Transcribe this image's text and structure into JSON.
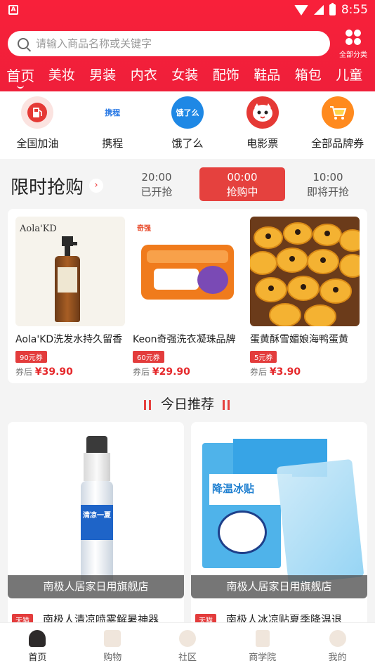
{
  "status": {
    "time": "8:55",
    "app_badge": "A"
  },
  "search": {
    "placeholder": "请输入商品名称或关键字"
  },
  "all_categories": {
    "label": "全部分类"
  },
  "tabs": [
    {
      "label": "首页"
    },
    {
      "label": "美妆"
    },
    {
      "label": "男装"
    },
    {
      "label": "内衣"
    },
    {
      "label": "女装"
    },
    {
      "label": "配饰"
    },
    {
      "label": "鞋品"
    },
    {
      "label": "箱包"
    },
    {
      "label": "儿童"
    }
  ],
  "services": [
    {
      "label": "全国加油",
      "icon": "fuel-icon",
      "color": "#e53935"
    },
    {
      "label": "携程",
      "icon": "ctrip-icon",
      "color": "#2c7be5",
      "text": "携程"
    },
    {
      "label": "饿了么",
      "icon": "eleme-icon",
      "color": "#1e88e5",
      "text": "饿了么"
    },
    {
      "label": "电影票",
      "icon": "movie-icon",
      "color": "#e53935"
    },
    {
      "label": "全部品牌券",
      "icon": "cart-icon",
      "color": "#ff8a1e"
    }
  ],
  "flash_sale": {
    "title": "限时抢购",
    "slots": [
      {
        "time": "20:00",
        "status": "已开抢"
      },
      {
        "time": "00:00",
        "status": "抢购中"
      },
      {
        "time": "10:00",
        "status": "即将开抢"
      }
    ],
    "items": [
      {
        "name": "Aola'KD洗发水持久留香",
        "coupon": "90元券",
        "price_label": "券后",
        "price": "¥39.90",
        "brand_text": "Aola'KD"
      },
      {
        "name": "Keon奇强洗衣凝珠品牌",
        "coupon": "60元券",
        "price_label": "券后",
        "price": "¥29.90",
        "brand_text": "奇强"
      },
      {
        "name": "蛋黄酥雪媚娘海鸭蛋黄",
        "coupon": "5元券",
        "price_label": "券后",
        "price": "¥3.90"
      }
    ]
  },
  "recommend": {
    "title": "今日推荐",
    "items": [
      {
        "shop": "南极人居家日用旗舰店",
        "tag": "天猫",
        "name": "南极人清凉喷雾解暑神器",
        "product_text": "清凉一夏"
      },
      {
        "shop": "南极人居家日用旗舰店",
        "tag": "天猫",
        "name": "南极人冰凉贴夏季降温退",
        "product_text": "降温冰贴"
      }
    ]
  },
  "bottom_nav": [
    {
      "label": "首页"
    },
    {
      "label": "购物"
    },
    {
      "label": "社区"
    },
    {
      "label": "商学院"
    },
    {
      "label": "我的"
    }
  ]
}
